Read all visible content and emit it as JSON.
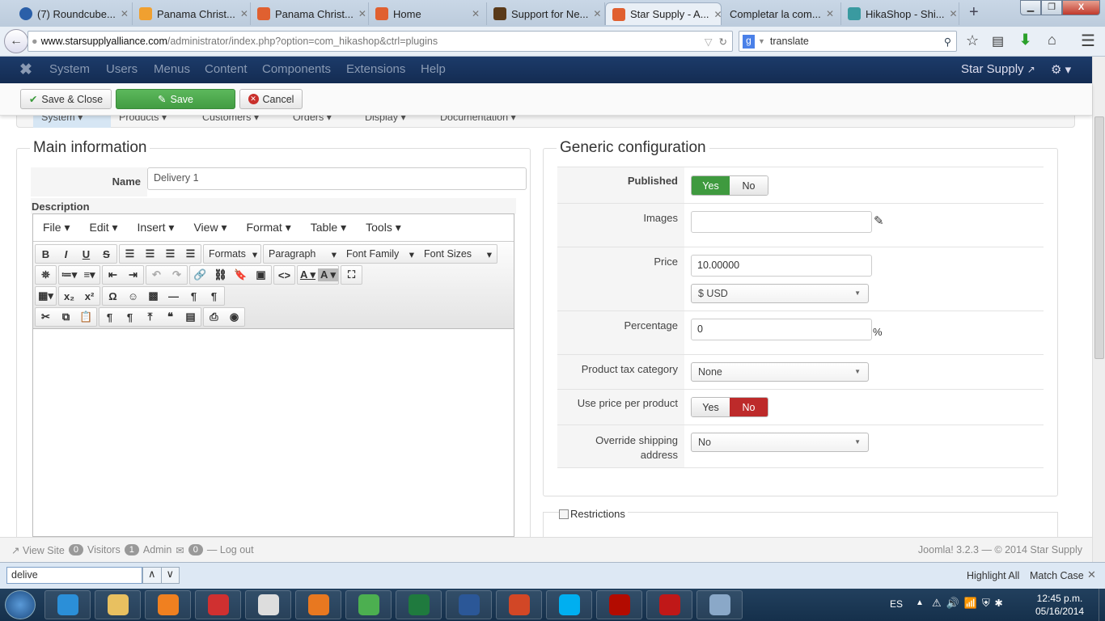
{
  "browser": {
    "tabs": [
      {
        "label": "(7) Roundcube...",
        "color": "#2a5fa8"
      },
      {
        "label": "Panama Christ...",
        "color": "#f0a030"
      },
      {
        "label": "Panama Christ...",
        "color": "#e06030"
      },
      {
        "label": "Home",
        "color": "#e06030"
      },
      {
        "label": "Support for Ne...",
        "color": "#5a3a1a"
      },
      {
        "label": "Star Supply - A...",
        "color": "#e06030",
        "active": true
      },
      {
        "label": "Completar la com...",
        "color": ""
      },
      {
        "label": "HikaShop - Shi...",
        "color": "#3a9aa0"
      }
    ],
    "new_tab": "+",
    "url_domain": "www.starsupplyalliance.com",
    "url_path": "/administrator/index.php?option=com_hikashop&ctrl=plugins",
    "search_value": "translate"
  },
  "joomla": {
    "menu": [
      "System",
      "Users",
      "Menus",
      "Content",
      "Components",
      "Extensions",
      "Help"
    ],
    "site_link": "Star Supply"
  },
  "toolbar": {
    "save_close": "Save & Close",
    "save": "Save",
    "cancel": "Cancel"
  },
  "submenu": [
    "System",
    "Products",
    "Customers",
    "Orders",
    "Display",
    "Documentation"
  ],
  "main": {
    "legend": "Main information",
    "name_label": "Name",
    "name_value": "Delivery 1",
    "description_label": "Description",
    "editor_menu": [
      "File",
      "Edit",
      "Insert",
      "View",
      "Format",
      "Table",
      "Tools"
    ],
    "formats": "Formats",
    "paragraph": "Paragraph",
    "font_family": "Font Family",
    "font_sizes": "Font Sizes"
  },
  "generic": {
    "legend": "Generic configuration",
    "published_label": "Published",
    "yes": "Yes",
    "no": "No",
    "published": "Yes",
    "images_label": "Images",
    "images_value": "",
    "price_label": "Price",
    "price_value": "10.00000",
    "currency": "$ USD",
    "percentage_label": "Percentage",
    "percentage_value": "0",
    "percent_sign": "%",
    "tax_label": "Product tax category",
    "tax_value": "None",
    "use_price_label": "Use price per product",
    "use_price": "No",
    "override_label_1": "Override shipping",
    "override_label_2": "address",
    "override_value": "No"
  },
  "restrictions": {
    "label": "Restrictions",
    "checked": false
  },
  "status": {
    "view_site": "View Site",
    "visitors_count": "0",
    "visitors": "Visitors",
    "admin_count": "1",
    "admin": "Admin",
    "messages_count": "0",
    "logout": "Log out",
    "version": "Joomla! 3.2.3 — © 2014 Star Supply"
  },
  "findbar": {
    "value": "delive",
    "highlight_all": "Highlight All",
    "match_case": "Match Case"
  },
  "taskbar": {
    "lang": "ES",
    "time": "12:45 p.m.",
    "date": "05/16/2014",
    "apps": [
      {
        "name": "internet-explorer",
        "color": "#2b8fd8"
      },
      {
        "name": "file-explorer",
        "color": "#e8c060"
      },
      {
        "name": "media-player",
        "color": "#f08020"
      },
      {
        "name": "todoist",
        "color": "#d03030"
      },
      {
        "name": "clock",
        "color": "#ddd"
      },
      {
        "name": "firefox",
        "color": "#e87820"
      },
      {
        "name": "chrome",
        "color": "#4caf50"
      },
      {
        "name": "excel",
        "color": "#1f7a3e"
      },
      {
        "name": "word",
        "color": "#2b5797"
      },
      {
        "name": "powerpoint",
        "color": "#d24726"
      },
      {
        "name": "skype",
        "color": "#00aff0"
      },
      {
        "name": "acrobat",
        "color": "#b30b00"
      },
      {
        "name": "mcafee",
        "color": "#c01818"
      },
      {
        "name": "calculator",
        "color": "#8aa8c8"
      }
    ]
  }
}
